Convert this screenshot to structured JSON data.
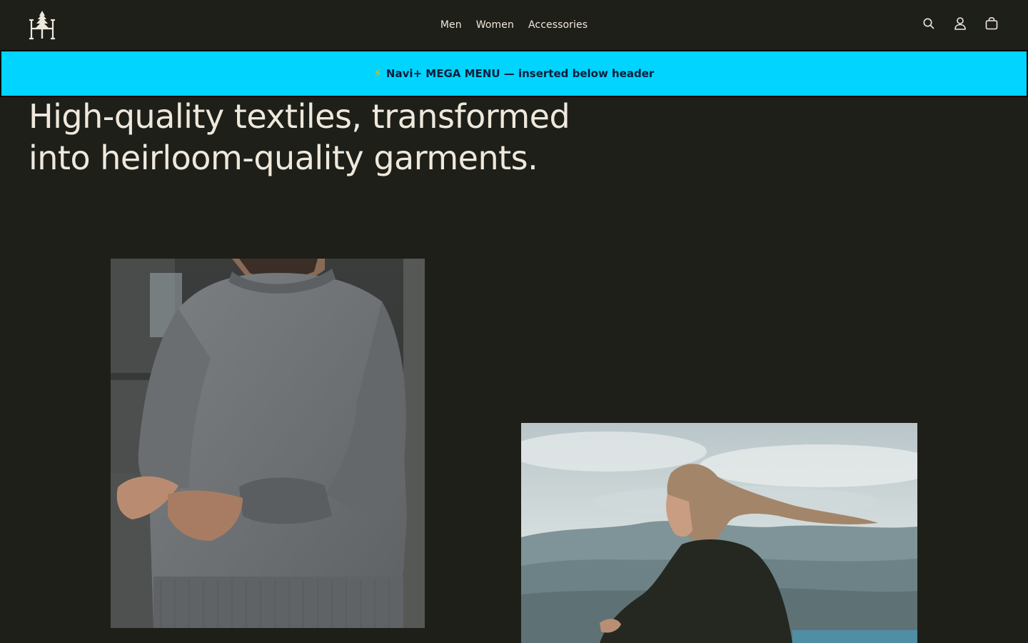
{
  "header": {
    "logo_icon": "tree-monogram-logo",
    "nav": [
      {
        "label": "Men"
      },
      {
        "label": "Women"
      },
      {
        "label": "Accessories"
      }
    ],
    "icons": [
      "search-icon",
      "account-icon",
      "cart-icon"
    ]
  },
  "mega_menu": {
    "icon": "⚡",
    "text": "Navi+ MEGA MENU — inserted below header",
    "background": "#00d4ff"
  },
  "hero": {
    "title_line1": "High-quality textiles, transformed",
    "title_line2": "into heirloom-quality garments."
  },
  "images": [
    {
      "name": "man-in-gray-sweater-photo"
    },
    {
      "name": "woman-windswept-hair-photo"
    }
  ],
  "colors": {
    "background": "#1f1f1a",
    "text": "#efe9dc",
    "banner": "#00d4ff"
  }
}
